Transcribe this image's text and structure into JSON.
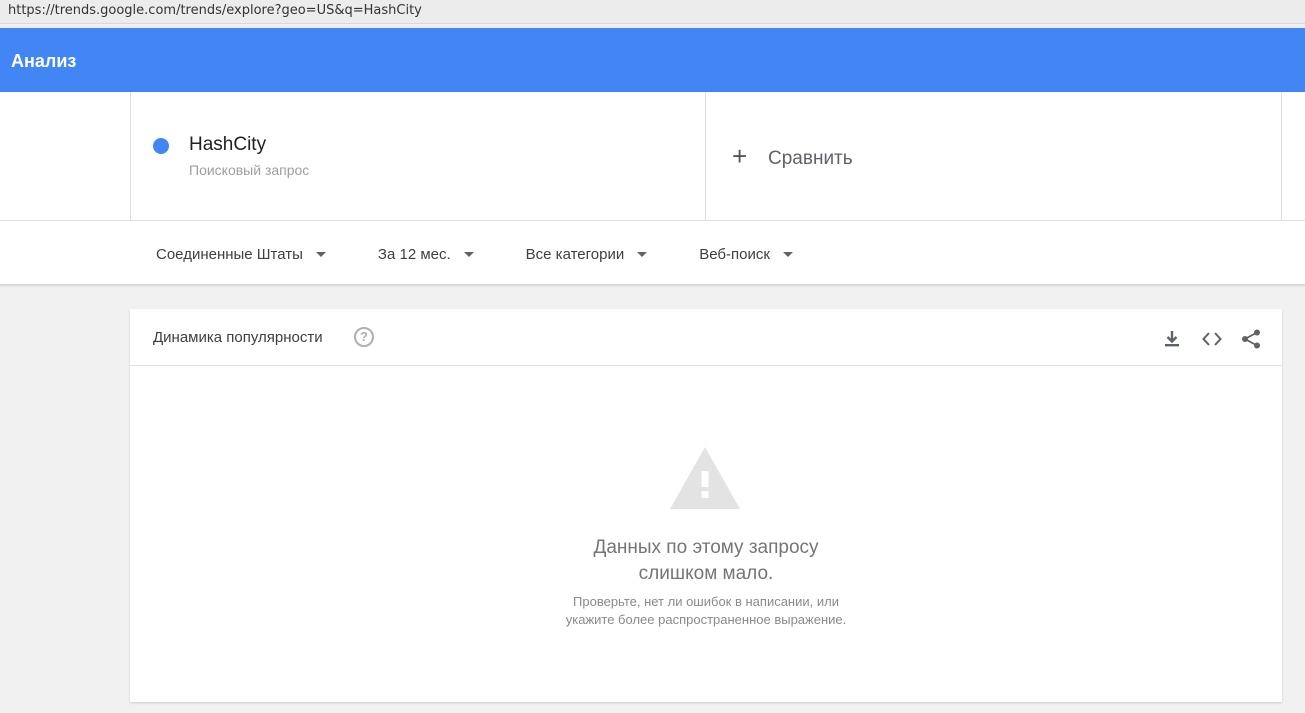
{
  "browser": {
    "url": "https://trends.google.com/trends/explore?geo=US&q=HashCity"
  },
  "appbar": {
    "title": "Анализ",
    "color": "#4285f4"
  },
  "term": {
    "name": "HashCity",
    "type": "Поисковый запрос",
    "dot_color": "#4285f4"
  },
  "compare": {
    "icon": "plus-icon",
    "label": "Сравнить"
  },
  "filters": {
    "region": "Соединенные Штаты",
    "period": "За 12 мес.",
    "category": "Все категории",
    "search_type": "Веб-поиск"
  },
  "panel": {
    "title": "Динамика популярности",
    "help_icon": "help-circle-icon",
    "tools": [
      "download-icon",
      "embed-code-icon",
      "share-icon"
    ],
    "empty": {
      "icon": "warning-triangle-icon",
      "line1": "Данных по этому запросу",
      "line2": "слишком мало.",
      "hint1": "Проверьте, нет ли ошибок в написании, или",
      "hint2": "укажите более распространенное выражение."
    }
  }
}
